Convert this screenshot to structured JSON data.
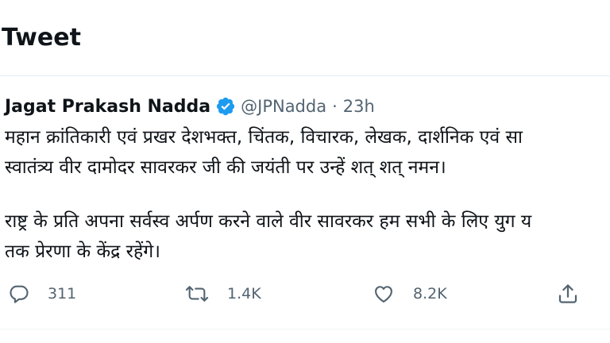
{
  "header": {
    "title": "Tweet"
  },
  "tweet": {
    "author_name": "Jagat Prakash Nadda",
    "handle": "@JPNadda",
    "separator": "·",
    "time": "23h",
    "paragraphs": [
      {
        "line1": "महान क्रांतिकारी एवं प्रखर देशभक्त, चिंतक, विचारक, लेखक, दार्शनिक एवं सा",
        "line2": "स्वातंत्र्य वीर दामोदर सावरकर जी की जयंती पर उन्हें शत् शत् नमन।"
      },
      {
        "line1": "राष्ट्र के प्रति अपना सर्वस्व अर्पण करने वाले वीर सावरकर हम सभी के लिए युग य",
        "line2": "तक प्रेरणा के केंद्र रहेंगे।"
      }
    ],
    "actions": {
      "reply_count": "311",
      "retweet_count": "1.4K",
      "like_count": "8.2K"
    }
  },
  "colors": {
    "verified_blue": "#1d9bf0",
    "secondary_text": "#536471",
    "primary_text": "#0f1419"
  },
  "icons": {
    "reply": "reply-icon",
    "retweet": "retweet-icon",
    "like": "like-icon",
    "share": "share-icon",
    "verified": "verified-badge-icon"
  }
}
